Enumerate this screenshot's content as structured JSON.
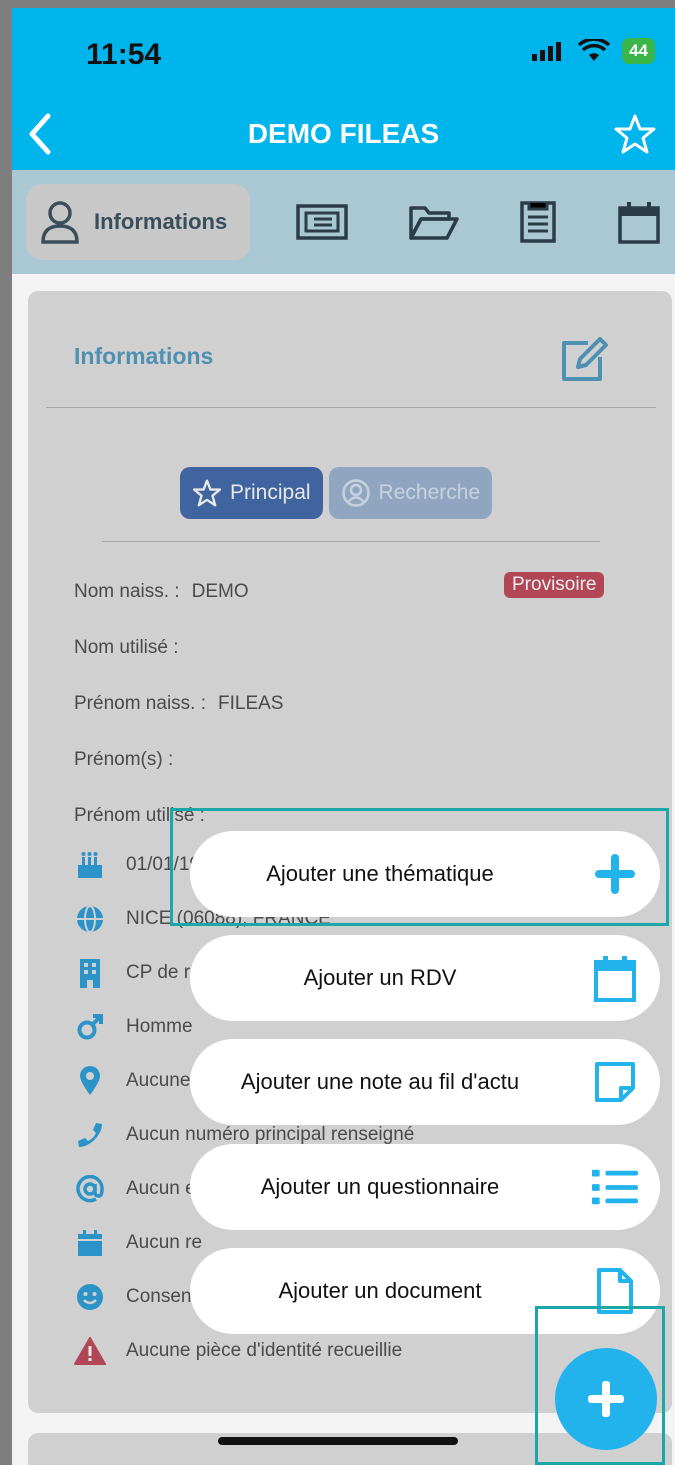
{
  "status": {
    "time": "11:54",
    "battery": "44"
  },
  "nav": {
    "title": "DEMO FILEAS"
  },
  "tabs": {
    "active_label": "Informations"
  },
  "card": {
    "title": "Informations",
    "segments": {
      "principal": "Principal",
      "recherche": "Recherche"
    },
    "badge": "Provisoire",
    "fields": [
      {
        "label": "Nom naiss. :",
        "value": "DEMO"
      },
      {
        "label": "Nom utilisé :",
        "value": ""
      },
      {
        "label": "Prénom naiss. :",
        "value": "FILEAS"
      },
      {
        "label": "Prénom(s) :",
        "value": ""
      },
      {
        "label": "Prénom utilisé :",
        "value": ""
      }
    ],
    "info_rows": [
      {
        "icon": "birthday-cake-icon",
        "text": "01/01/19"
      },
      {
        "icon": "globe-icon",
        "text": "NICE (06088), FRANCE"
      },
      {
        "icon": "building-icon",
        "text": "CP de r"
      },
      {
        "icon": "male-icon",
        "text": "Homme"
      },
      {
        "icon": "map-pin-icon",
        "text": "Aucune"
      },
      {
        "icon": "phone-icon",
        "text": "Aucun numéro principal renseigné"
      },
      {
        "icon": "at-icon",
        "text": "Aucun e"
      },
      {
        "icon": "calendar-icon",
        "text": "Aucun re"
      },
      {
        "icon": "smiley-icon",
        "text": "Consen"
      },
      {
        "icon": "warning-icon",
        "text": "Aucune pièce d'identité recueillie"
      }
    ]
  },
  "menu": {
    "items": [
      {
        "label": "Ajouter une thématique",
        "icon": "plus-icon"
      },
      {
        "label": "Ajouter un RDV",
        "icon": "calendar-icon"
      },
      {
        "label": "Ajouter une note au fil d'actu",
        "icon": "note-icon"
      },
      {
        "label": "Ajouter un questionnaire",
        "icon": "list-icon"
      },
      {
        "label": "Ajouter un document",
        "icon": "document-icon"
      }
    ]
  },
  "colors": {
    "accent": "#00b4ec",
    "fab": "#22b3ec",
    "highlight": "#1aa7a8",
    "badge": "#b04656"
  }
}
